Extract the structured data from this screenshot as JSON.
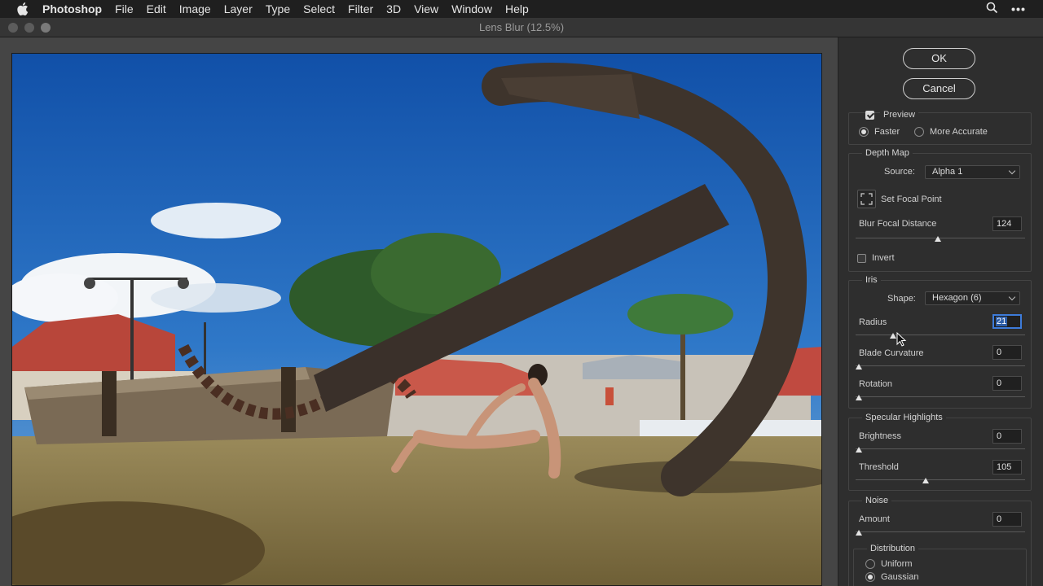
{
  "menubar": {
    "app": "Photoshop",
    "items": [
      "File",
      "Edit",
      "Image",
      "Layer",
      "Type",
      "Select",
      "Filter",
      "3D",
      "View",
      "Window",
      "Help"
    ]
  },
  "window": {
    "title": "Lens Blur (12.5%)"
  },
  "buttons": {
    "ok": "OK",
    "cancel": "Cancel"
  },
  "preview": {
    "label": "Preview",
    "checked": true,
    "mode_faster": "Faster",
    "mode_accurate": "More Accurate",
    "selected_mode": "Faster"
  },
  "depth_map": {
    "title": "Depth Map",
    "source_label": "Source:",
    "source_value": "Alpha 1",
    "set_focal_point": "Set Focal Point",
    "blur_focal_distance_label": "Blur Focal Distance",
    "blur_focal_distance_value": "124",
    "blur_focal_distance_fraction": 0.486,
    "invert_label": "Invert",
    "invert_checked": false
  },
  "iris": {
    "title": "Iris",
    "shape_label": "Shape:",
    "shape_value": "Hexagon (6)",
    "radius_label": "Radius",
    "radius_value": "21",
    "radius_fraction": 0.21,
    "blade_curvature_label": "Blade Curvature",
    "blade_curvature_value": "0",
    "blade_curvature_fraction": 0,
    "rotation_label": "Rotation",
    "rotation_value": "0",
    "rotation_fraction": 0
  },
  "specular_highlights": {
    "title": "Specular Highlights",
    "brightness_label": "Brightness",
    "brightness_value": "0",
    "brightness_fraction": 0,
    "threshold_label": "Threshold",
    "threshold_value": "105",
    "threshold_fraction": 0.41
  },
  "noise": {
    "title": "Noise",
    "amount_label": "Amount",
    "amount_value": "0",
    "amount_fraction": 0,
    "distribution_title": "Distribution",
    "uniform_label": "Uniform",
    "gaussian_label": "Gaussian",
    "selected_distribution": "Gaussian"
  },
  "icons": [
    "apple-icon",
    "search-icon",
    "more-icon",
    "focal-point-icon",
    "dropdown-caret-icon",
    "cursor-icon"
  ]
}
